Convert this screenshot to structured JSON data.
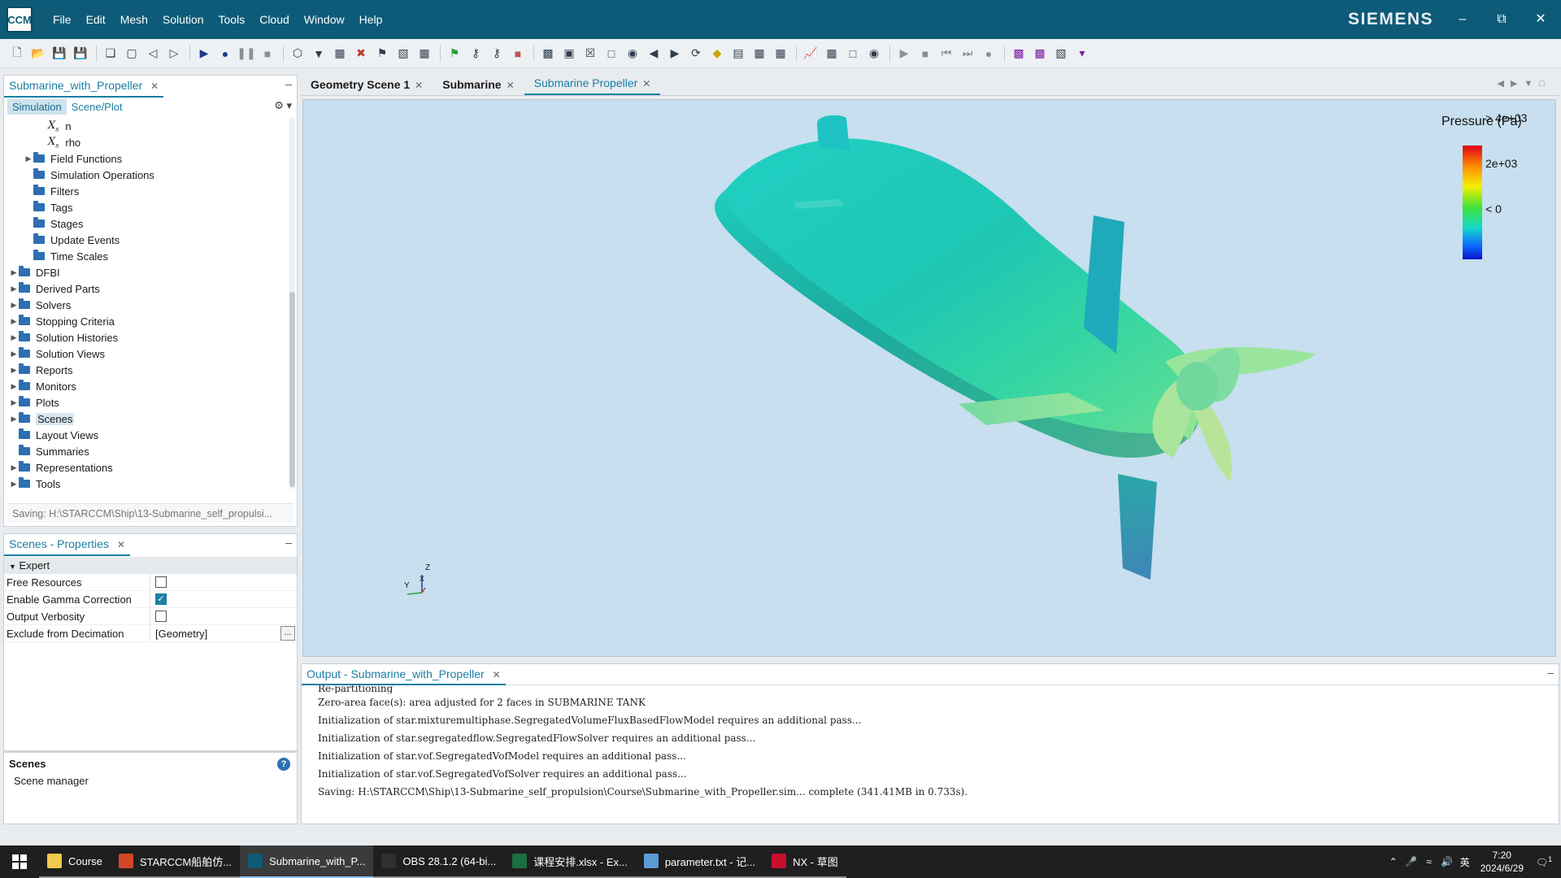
{
  "app": {
    "logo_text": "CCM",
    "brand": "SIEMENS",
    "menu": [
      "File",
      "Edit",
      "Mesh",
      "Solution",
      "Tools",
      "Cloud",
      "Window",
      "Help"
    ]
  },
  "sim_panel": {
    "tab_label": "Submarine_with_Propeller",
    "sub_tabs": [
      "Simulation",
      "Scene/Plot"
    ],
    "tree": [
      {
        "label": "n",
        "kind": "var",
        "indent": 2
      },
      {
        "label": "rho",
        "kind": "var",
        "indent": 2
      },
      {
        "label": "Field Functions",
        "kind": "folder",
        "indent": 1,
        "expandable": true
      },
      {
        "label": "Simulation Operations",
        "kind": "folder",
        "indent": 1,
        "expandable": false
      },
      {
        "label": "Filters",
        "kind": "folder",
        "indent": 1,
        "expandable": false
      },
      {
        "label": "Tags",
        "kind": "folder",
        "indent": 1,
        "expandable": false
      },
      {
        "label": "Stages",
        "kind": "folder",
        "indent": 1,
        "expandable": false
      },
      {
        "label": "Update Events",
        "kind": "folder",
        "indent": 1,
        "expandable": false
      },
      {
        "label": "Time Scales",
        "kind": "folder",
        "indent": 1,
        "expandable": false
      },
      {
        "label": "DFBI",
        "kind": "folder",
        "indent": 0,
        "expandable": true
      },
      {
        "label": "Derived Parts",
        "kind": "folder",
        "indent": 0,
        "expandable": true
      },
      {
        "label": "Solvers",
        "kind": "folder",
        "indent": 0,
        "expandable": true
      },
      {
        "label": "Stopping Criteria",
        "kind": "folder",
        "indent": 0,
        "expandable": true
      },
      {
        "label": "Solution Histories",
        "kind": "folder",
        "indent": 0,
        "expandable": true
      },
      {
        "label": "Solution Views",
        "kind": "folder",
        "indent": 0,
        "expandable": true
      },
      {
        "label": "Reports",
        "kind": "folder",
        "indent": 0,
        "expandable": true
      },
      {
        "label": "Monitors",
        "kind": "folder",
        "indent": 0,
        "expandable": true
      },
      {
        "label": "Plots",
        "kind": "folder",
        "indent": 0,
        "expandable": true
      },
      {
        "label": "Scenes",
        "kind": "folder",
        "indent": 0,
        "expandable": true,
        "selected": true
      },
      {
        "label": "Layout Views",
        "kind": "folder",
        "indent": 0,
        "expandable": false
      },
      {
        "label": "Summaries",
        "kind": "folder",
        "indent": 0,
        "expandable": false
      },
      {
        "label": "Representations",
        "kind": "folder",
        "indent": 0,
        "expandable": true
      },
      {
        "label": "Tools",
        "kind": "folder",
        "indent": 0,
        "expandable": true
      }
    ],
    "status_text": "Saving: H:\\STARCCM\\Ship\\13-Submarine_self_propulsi..."
  },
  "props_panel": {
    "tab_label": "Scenes - Properties",
    "group": "Expert",
    "rows": [
      {
        "name": "Free Resources",
        "type": "checkbox",
        "checked": false
      },
      {
        "name": "Enable Gamma Correction",
        "type": "checkbox",
        "checked": true
      },
      {
        "name": "Output Verbosity",
        "type": "checkbox",
        "checked": false
      },
      {
        "name": "Exclude from Decimation",
        "type": "text",
        "value": "[Geometry]"
      }
    ],
    "help_title": "Scenes",
    "help_desc": "Scene manager"
  },
  "editor": {
    "tabs": [
      "Geometry Scene 1",
      "Submarine",
      "Submarine Propeller"
    ],
    "active_tab_index": 2
  },
  "scene": {
    "legend_title": "Pressure (Pa)",
    "legend_ticks": [
      "> 4e+03",
      "2e+03",
      "< 0"
    ],
    "triad_labels": {
      "z": "Z",
      "y": "Y",
      "x": "X"
    },
    "colors": {
      "background": "#c7dfee",
      "hull": "#22c9b8",
      "fin": "#6fd98a"
    }
  },
  "output": {
    "tab_label": "Output - Submarine_with_Propeller",
    "lines": [
      "Re-partitioning",
      "Zero-area face(s): area adjusted for 2 faces in SUBMARINE TANK",
      "Initialization of star.mixturemultiphase.SegregatedVolumeFluxBasedFlowModel requires an additional pass...",
      "Initialization of star.segregatedflow.SegregatedFlowSolver requires an additional pass...",
      "Initialization of star.vof.SegregatedVofModel requires an additional pass...",
      "Initialization of star.vof.SegregatedVofSolver requires an additional pass...",
      "Saving: H:\\STARCCM\\Ship\\13-Submarine_self_propulsion\\Course\\Submarine_with_Propeller.sim... complete (341.41MB in 0.733s)."
    ]
  },
  "taskbar": {
    "items": [
      {
        "label": "Course",
        "icon": "folder-icon",
        "color": "#f2c94c"
      },
      {
        "label": "STARCCM船舶仿...",
        "icon": "powerpoint-icon",
        "color": "#d24726"
      },
      {
        "label": "Submarine_with_P...",
        "icon": "starccm-icon",
        "color": "#0d5b78",
        "active": true
      },
      {
        "label": "OBS 28.1.2 (64-bi...",
        "icon": "obs-icon",
        "color": "#302e31"
      },
      {
        "label": "课程安排.xlsx - Ex...",
        "icon": "excel-icon",
        "color": "#1d6f42"
      },
      {
        "label": "parameter.txt - 记...",
        "icon": "notepad-icon",
        "color": "#5b9bd5"
      },
      {
        "label": "NX - 草图",
        "icon": "nx-icon",
        "color": "#c8102e"
      }
    ],
    "ime": "英",
    "time": "7:20",
    "date": "2024/6/29",
    "notification_count": "1"
  }
}
